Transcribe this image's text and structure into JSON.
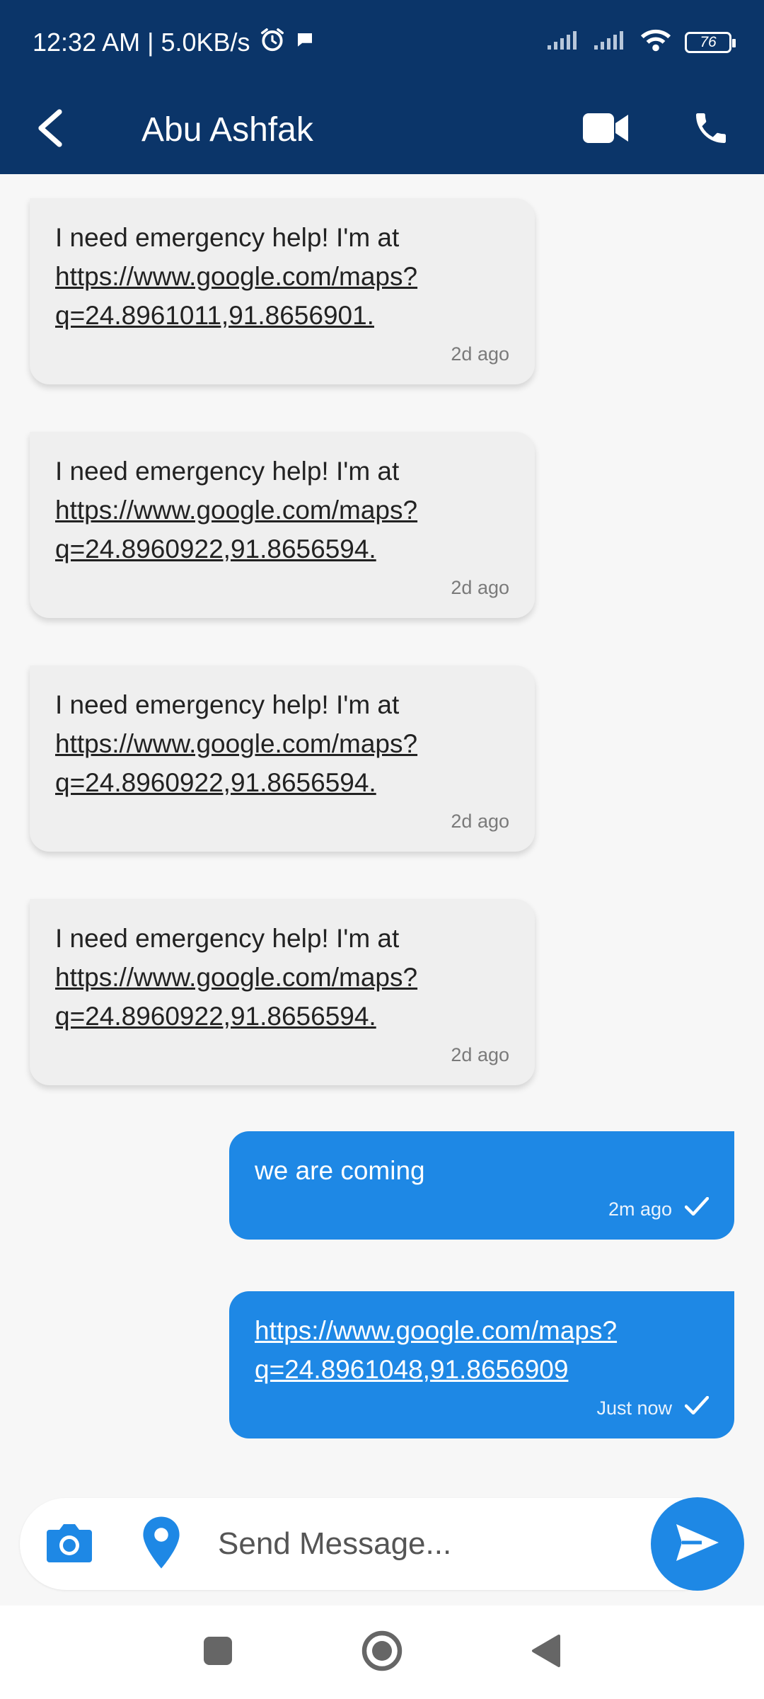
{
  "status_bar": {
    "time_speed": "12:32 AM | 5.0KB/s",
    "battery": "76"
  },
  "header": {
    "contact_name": "Abu Ashfak",
    "icons": [
      "back-arrow-icon",
      "video-call-icon",
      "phone-call-icon"
    ]
  },
  "messages": [
    {
      "direction": "in",
      "prefix": "I need emergency help! I'm at ",
      "link": "https://www.google.com/maps?q=24.8961011,91.8656901.",
      "time": "2d ago"
    },
    {
      "direction": "in",
      "prefix": "I need emergency help! I'm at ",
      "link": "https://www.google.com/maps?q=24.8960922,91.8656594.",
      "time": "2d ago"
    },
    {
      "direction": "in",
      "prefix": "I need emergency help! I'm at ",
      "link": "https://www.google.com/maps?q=24.8960922,91.8656594.",
      "time": "2d ago"
    },
    {
      "direction": "in",
      "prefix": "I need emergency help! I'm at ",
      "link": "https://www.google.com/maps?q=24.8960922,91.8656594.",
      "time": "2d ago"
    },
    {
      "direction": "out",
      "text": "we are coming",
      "time": "2m ago"
    },
    {
      "direction": "out",
      "link": "https://www.google.com/maps?q=24.8961048,91.8656909",
      "time": "Just now"
    }
  ],
  "composer": {
    "placeholder": "Send Message...",
    "icons": [
      "camera-icon",
      "location-pin-icon",
      "send-icon"
    ]
  },
  "navigation": {
    "icons": [
      "recents-square-icon",
      "home-circle-icon",
      "back-triangle-icon"
    ]
  },
  "colors": {
    "header": "#0b3569",
    "outgoing_bubble": "#1e88e5",
    "incoming_bubble": "#efefef"
  }
}
